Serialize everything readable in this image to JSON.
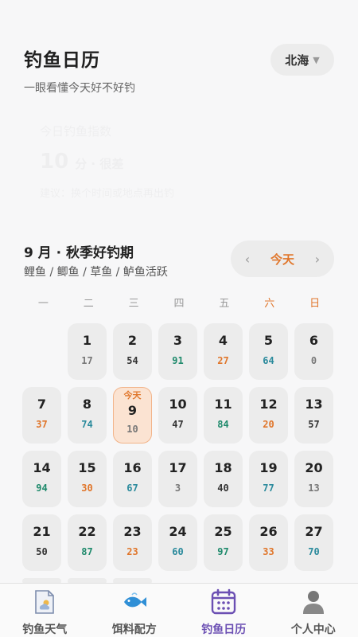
{
  "header": {
    "title": "钓鱼日历",
    "subtitle": "一眼看懂今天好不好钓"
  },
  "region": {
    "label": "北海",
    "caret": "▼"
  },
  "today_card": {
    "label": "今日钓鱼指数",
    "score": "10",
    "unit": "分 · 很差",
    "advice": "建议：换个时间或地点再出钓"
  },
  "month": {
    "title": "9 月 · 秋季好钓期",
    "subtitle": "鲤鱼 / 鲫鱼 / 草鱼 / 鲈鱼活跃"
  },
  "today_nav": {
    "prev": "‹",
    "label": "今天",
    "next": "›"
  },
  "weekdays": [
    "一",
    "二",
    "三",
    "四",
    "五",
    "六",
    "日"
  ],
  "calendar": {
    "today_tag": "今天",
    "days": [
      {
        "day": "",
        "score": ""
      },
      {
        "day": "1",
        "score": "17",
        "color": "#777777"
      },
      {
        "day": "2",
        "score": "54",
        "color": "#333333"
      },
      {
        "day": "3",
        "score": "91",
        "color": "#1f8a6c"
      },
      {
        "day": "4",
        "score": "27",
        "color": "#e0762b"
      },
      {
        "day": "5",
        "score": "64",
        "color": "#2a8a9c"
      },
      {
        "day": "6",
        "score": "0",
        "color": "#777777"
      },
      {
        "day": "7",
        "score": "37",
        "color": "#e0762b"
      },
      {
        "day": "8",
        "score": "74",
        "color": "#2a8a9c"
      },
      {
        "day": "9",
        "score": "10",
        "color": "#777777",
        "today": true
      },
      {
        "day": "10",
        "score": "47",
        "color": "#333333"
      },
      {
        "day": "11",
        "score": "84",
        "color": "#1f8a6c"
      },
      {
        "day": "12",
        "score": "20",
        "color": "#e0762b"
      },
      {
        "day": "13",
        "score": "57",
        "color": "#333333"
      },
      {
        "day": "14",
        "score": "94",
        "color": "#1f8a6c"
      },
      {
        "day": "15",
        "score": "30",
        "color": "#e0762b"
      },
      {
        "day": "16",
        "score": "67",
        "color": "#2a8a9c"
      },
      {
        "day": "17",
        "score": "3",
        "color": "#777777"
      },
      {
        "day": "18",
        "score": "40",
        "color": "#333333"
      },
      {
        "day": "19",
        "score": "77",
        "color": "#2a8a9c"
      },
      {
        "day": "20",
        "score": "13",
        "color": "#777777"
      },
      {
        "day": "21",
        "score": "50",
        "color": "#333333"
      },
      {
        "day": "22",
        "score": "87",
        "color": "#1f8a6c"
      },
      {
        "day": "23",
        "score": "23",
        "color": "#e0762b"
      },
      {
        "day": "24",
        "score": "60",
        "color": "#2a8a9c"
      },
      {
        "day": "25",
        "score": "97",
        "color": "#1f8a6c"
      },
      {
        "day": "26",
        "score": "33",
        "color": "#e0762b"
      },
      {
        "day": "27",
        "score": "70",
        "color": "#2a8a9c"
      }
    ]
  },
  "tabs": [
    {
      "label": "钓鱼天气",
      "icon": "weather-icon",
      "active": false
    },
    {
      "label": "饵料配方",
      "icon": "fish-icon",
      "active": false
    },
    {
      "label": "钓鱼日历",
      "icon": "calendar-icon",
      "active": true
    },
    {
      "label": "个人中心",
      "icon": "user-icon",
      "active": false
    }
  ],
  "colors": {
    "accent": "#e0762b",
    "active_tab": "#6b4fb3"
  }
}
